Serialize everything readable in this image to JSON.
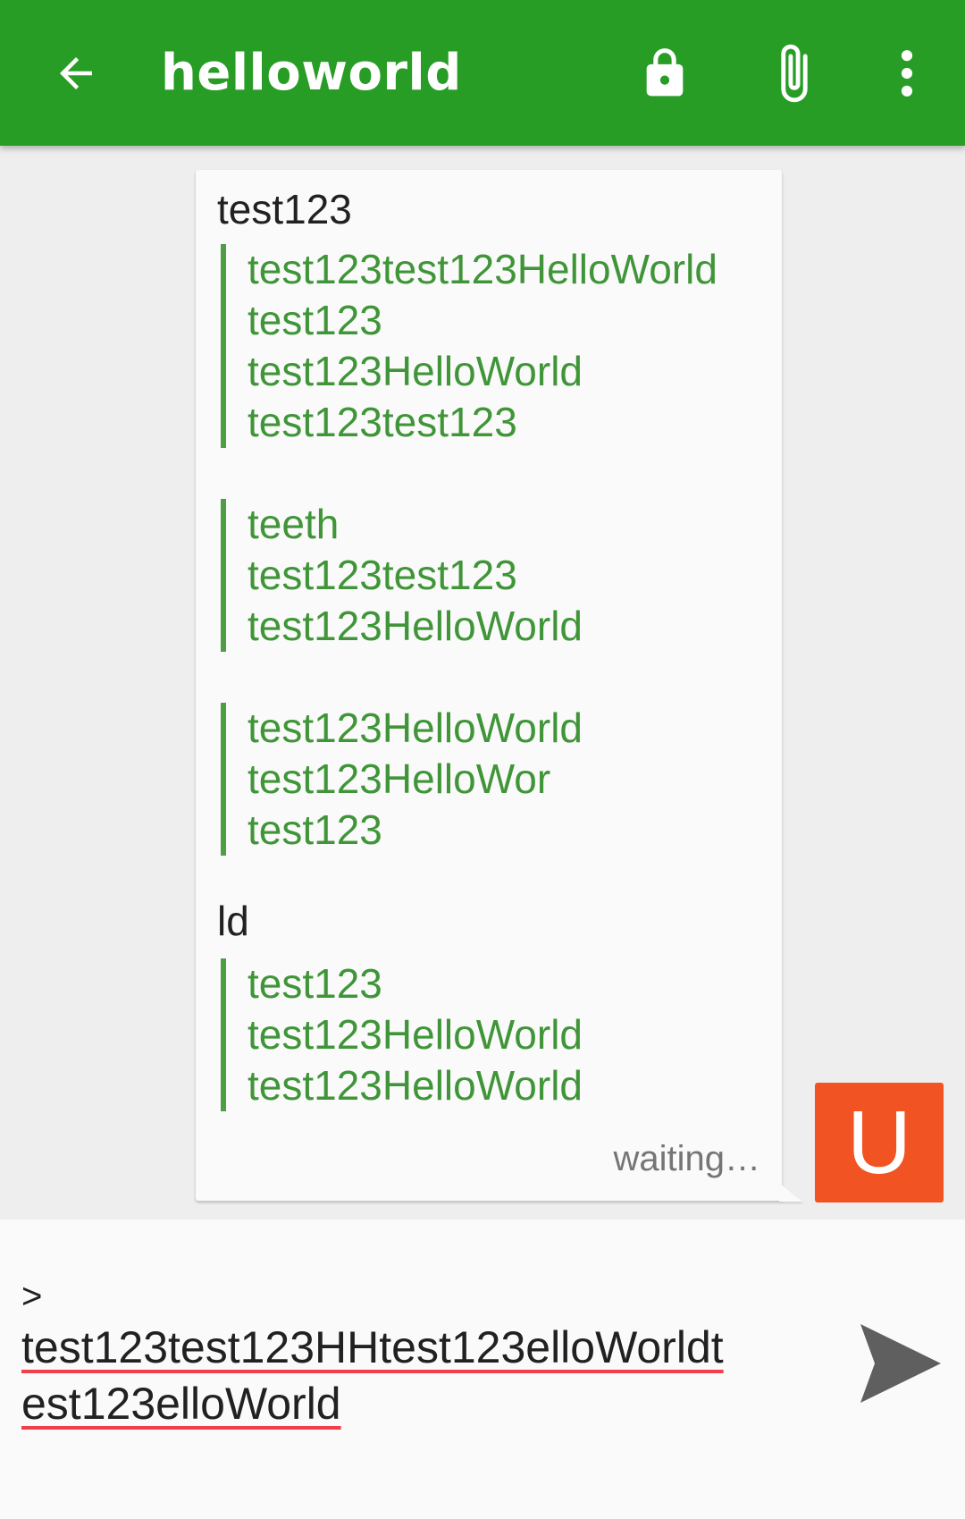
{
  "toolbar": {
    "title": "helloworld",
    "back_icon": "arrow-back-icon",
    "lock_icon": "lock-icon",
    "attach_icon": "paperclip-icon",
    "more_icon": "more-vert-icon",
    "color": "#289d26"
  },
  "message": {
    "blocks": [
      {
        "type": "text",
        "text": "test123"
      },
      {
        "type": "quote",
        "lines": [
          "test123test123HelloWorld",
          "test123",
          "test123HelloWorld",
          "test123test123"
        ]
      },
      {
        "type": "quote",
        "lines": [
          "teeth",
          "test123test123",
          "test123HelloWorld"
        ]
      },
      {
        "type": "quote",
        "lines": [
          "test123HelloWorld",
          "test123HelloWor",
          "test123"
        ]
      },
      {
        "type": "text",
        "text": "ld"
      },
      {
        "type": "quote",
        "lines": [
          "test123",
          "test123HelloWorld",
          "test123HelloWorld"
        ]
      }
    ],
    "status": "waiting…"
  },
  "avatar": {
    "letter": "U",
    "color": "#f25323"
  },
  "composer": {
    "prefix": ">",
    "line1": "test123test123HHtest123elloWorldt",
    "line2": "est123elloWorld",
    "send_icon": "send-icon"
  }
}
